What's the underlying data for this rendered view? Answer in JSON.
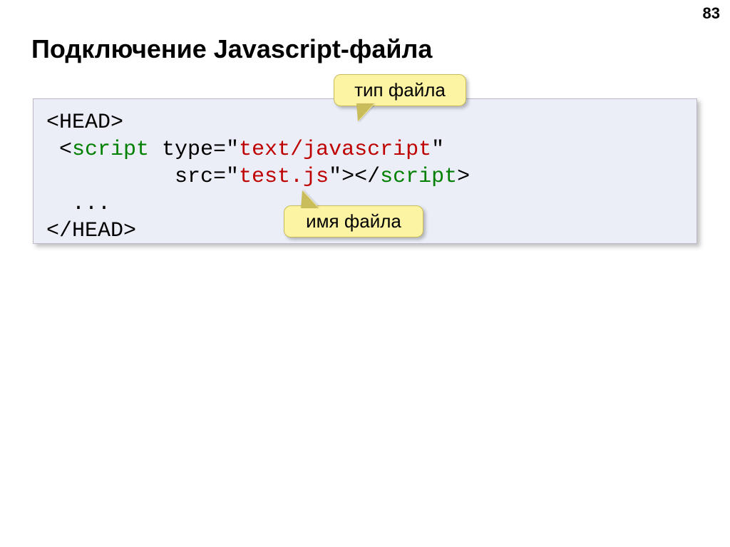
{
  "page_number": "83",
  "title": "Подключение Javascript-файла",
  "code": {
    "l1_a": "<HEAD>",
    "l2_a": " <",
    "l2_b": "script",
    "l2_c": " type=\"",
    "l2_d": "text/javascript",
    "l2_e": "\"",
    "l3_a": "          src=\"",
    "l3_b": "test.js",
    "l3_c": "\"></",
    "l3_d": "script",
    "l3_e": ">",
    "l4_a": "  ...",
    "l5_a": "</HEAD>"
  },
  "callouts": {
    "type_label": "тип файла",
    "name_label": "имя файла"
  }
}
